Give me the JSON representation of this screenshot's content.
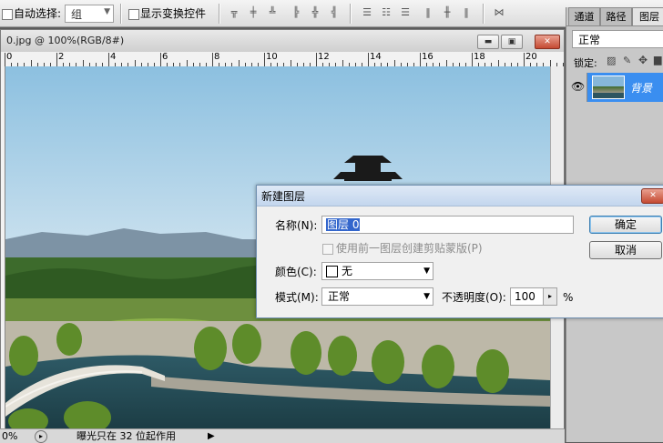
{
  "options_bar": {
    "auto_select_label": "自动选择:",
    "auto_select_value": "组",
    "show_transform_label": "显示变换控件"
  },
  "document": {
    "title": "0.jpg @ 100%(RGB/8#)",
    "ruler_numbers": [
      "0",
      "2",
      "4",
      "6",
      "8",
      "10",
      "12",
      "14",
      "16",
      "18",
      "20"
    ]
  },
  "status_bar": {
    "zoom": "0%",
    "message": "曝光只在 32 位起作用"
  },
  "layers_panel": {
    "tabs": [
      "通道",
      "路径",
      "图层"
    ],
    "blend_mode": "正常",
    "lock_label": "锁定:",
    "layer_name": "背景"
  },
  "dialog": {
    "title": "新建图层",
    "name_label": "名称(N):",
    "name_value": "图层 0",
    "clip_option_label": "使用前一图层创建剪贴蒙版(P)",
    "color_label": "颜色(C):",
    "color_value": "无",
    "mode_label": "模式(M):",
    "mode_value": "正常",
    "opacity_label": "不透明度(O):",
    "opacity_value": "100",
    "opacity_unit": "%",
    "ok_label": "确定",
    "cancel_label": "取消",
    "close_glyph": "✕"
  }
}
